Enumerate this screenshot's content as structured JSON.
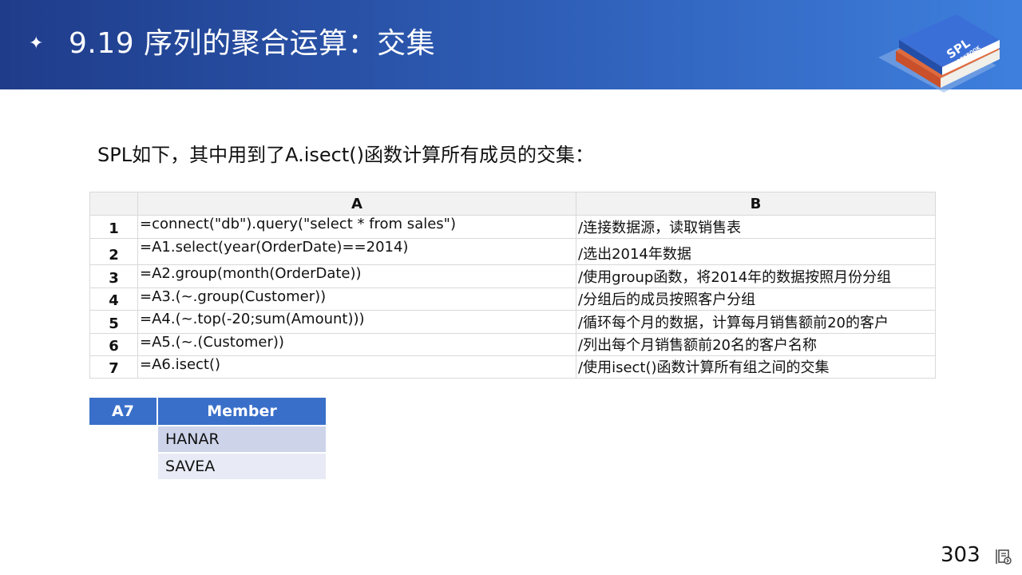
{
  "header": {
    "star_glyph": "✦",
    "title": "9.19 序列的聚合运算：交集",
    "logo_text": "SPL",
    "logo_subtext": "COOKBOOK"
  },
  "intro": "SPL如下，其中用到了A.isect()函数计算所有成员的交集：",
  "code_table": {
    "col_headers": [
      "A",
      "B"
    ],
    "rows": [
      {
        "num": "1",
        "a": "=connect(\"db\").query(\"select * from sales\")",
        "b": "/连接数据源，读取销售表"
      },
      {
        "num": "2",
        "a": "=A1.select(year(OrderDate)==2014)",
        "b": "/选出2014年数据"
      },
      {
        "num": "3",
        "a": "=A2.group(month(OrderDate))",
        "b": "/使用group函数，将2014年的数据按照月份分组"
      },
      {
        "num": "4",
        "a": "=A3.(~.group(Customer))",
        "b": "/分组后的成员按照客户分组"
      },
      {
        "num": "5",
        "a": "=A4.(~.top(-20;sum(Amount)))",
        "b": "/循环每个月的数据，计算每月销售额前20的客户"
      },
      {
        "num": "6",
        "a": "=A5.(~.(Customer))",
        "b": "/列出每个月销售额前20名的客户名称"
      },
      {
        "num": "7",
        "a": "=A6.isect()",
        "b": "/使用isect()函数计算所有组之间的交集"
      }
    ]
  },
  "result": {
    "label": "A7",
    "column": "Member",
    "values": [
      "HANAR",
      "SAVEA"
    ]
  },
  "footer": {
    "page_number": "303"
  },
  "colors": {
    "header_dark": "#1f3c8a",
    "header_light": "#3e7fdd",
    "result_header": "#3a6fc9",
    "result_row_odd": "#cdd4ea",
    "result_row_even": "#e8ebf5"
  }
}
